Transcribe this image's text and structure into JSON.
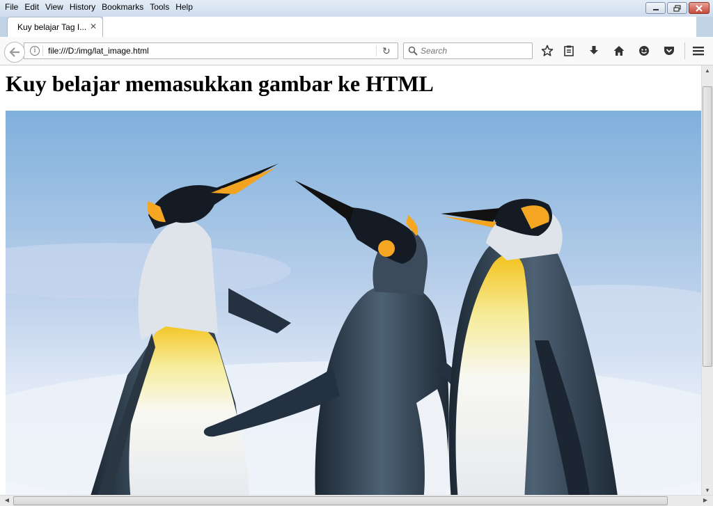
{
  "window": {
    "menu": [
      {
        "label": "File"
      },
      {
        "label": "Edit"
      },
      {
        "label": "View"
      },
      {
        "label": "History"
      },
      {
        "label": "Bookmarks"
      },
      {
        "label": "Tools"
      },
      {
        "label": "Help"
      }
    ],
    "controls": {
      "minimize_icon": "minimize-icon",
      "restore_icon": "restore-icon",
      "close_icon": "close-icon"
    }
  },
  "tab": {
    "title": "Kuy belajar Tag I...",
    "close_glyph": "✕"
  },
  "navbar": {
    "url": "file:///D:/img/lat_image.html",
    "info_glyph": "i",
    "reload_glyph": "↻",
    "search_placeholder": "Search"
  },
  "page": {
    "heading": "Kuy belajar memasukkan gambar ke HTML"
  },
  "colors": {
    "sky": "#8fb6dc",
    "accent_orange": "#f5a623"
  }
}
